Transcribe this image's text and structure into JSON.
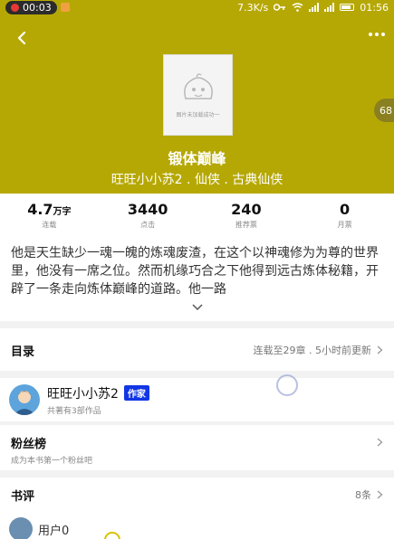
{
  "status_bar": {
    "time_pill": "00:03",
    "network_speed": "7.3K/s",
    "clock": "01:56"
  },
  "header": {
    "cover_caption": "图片未加载成功一",
    "side_badge": "68",
    "title": "锻体巅峰",
    "meta": "旺旺小小苏2 . 仙侠 . 古典仙侠"
  },
  "stats": [
    {
      "value": "4.7",
      "unit": "万字",
      "label": "连载"
    },
    {
      "value": "3440",
      "unit": "",
      "label": "点击"
    },
    {
      "value": "240",
      "unit": "",
      "label": "推荐票"
    },
    {
      "value": "0",
      "unit": "",
      "label": "月票"
    }
  ],
  "intro": "他是天生缺少一魂一魄的炼魂废渣，在这个以神魂修为为尊的世界里，他没有一席之位。然而机缘巧合之下他得到远古炼体秘籍，开辟了一条走向炼体巅峰的道路。他一路",
  "catalog": {
    "title": "目录",
    "status": "连载至29章 . 5小时前更新"
  },
  "author": {
    "name": "旺旺小小苏2",
    "tag": "作家",
    "works": "共著有3部作品"
  },
  "fans": {
    "title": "粉丝榜",
    "subtitle": "成为本书第一个粉丝吧"
  },
  "reviews": {
    "title": "书评",
    "count": "8条"
  },
  "first_review": {
    "user": "用户0"
  },
  "colors": {
    "header_bg": "#b6a804",
    "author_tag_bg": "#1236e5"
  }
}
